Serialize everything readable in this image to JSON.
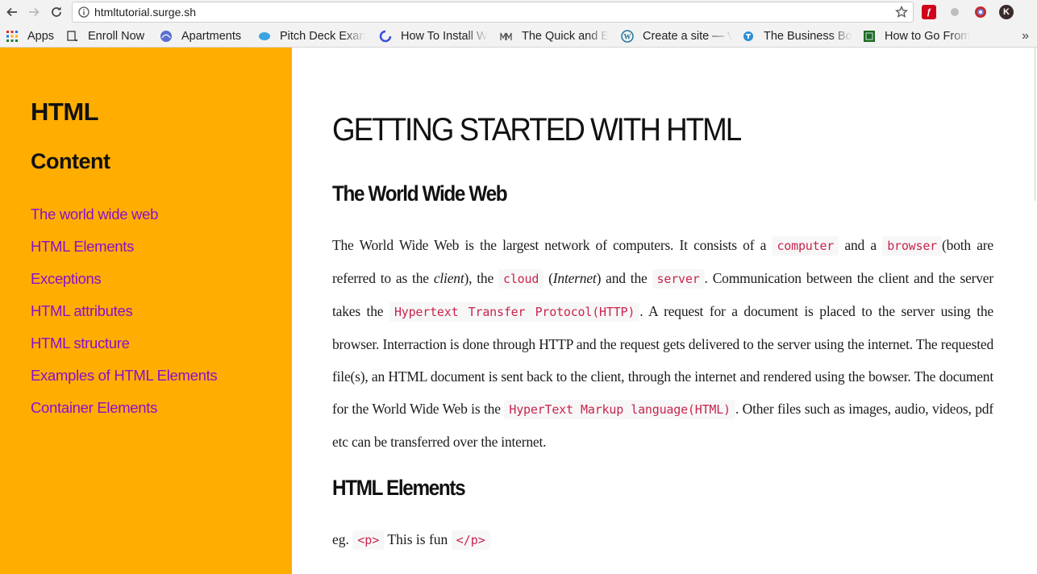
{
  "browser": {
    "url": "htmltutorial.surge.sh",
    "bookmarks": [
      {
        "label": "Apps",
        "icon": "apps-grid-icon"
      },
      {
        "label": "Enroll Now",
        "icon": "enroll-icon"
      },
      {
        "label": "Apartments",
        "icon": "apartments-icon"
      },
      {
        "label": "Pitch Deck Exan",
        "icon": "pitch-deck-icon"
      },
      {
        "label": "How To Install W",
        "icon": "how-to-install-icon"
      },
      {
        "label": "The Quick and E",
        "icon": "quick-and-icon"
      },
      {
        "label": "Create a site — V",
        "icon": "wordpress-icon"
      },
      {
        "label": "The Business Bo",
        "icon": "business-icon"
      },
      {
        "label": "How to Go From",
        "icon": "go-from-icon"
      }
    ],
    "more_symbol": "»"
  },
  "sidebar": {
    "title": "HTML",
    "subtitle": "Content",
    "links": [
      "The world wide web",
      "HTML Elements",
      "Exceptions",
      "HTML attributes",
      "HTML structure",
      "Examples of HTML Elements",
      "Container Elements"
    ]
  },
  "main": {
    "title": "GETTING STARTED WITH HTML",
    "section1": {
      "heading": "The World Wide Web",
      "t1": "The World Wide Web is the largest network of computers. It consists of a ",
      "c1": "computer",
      "t2": " and a ",
      "c2": "browser",
      "t3": "(both are referred to as the ",
      "e1": "client",
      "t4": "), the ",
      "c3": "cloud",
      "t5": " (",
      "e2": "Internet",
      "t6": ") and the ",
      "c4": "server",
      "t7": ". Communication between the client and the server takes the ",
      "c5": "Hypertext Transfer Protocol(HTTP)",
      "t8": ". A request for a document is placed to the server using the browser. Interraction is done through HTTP and the request gets delivered to the server using the internet. The requested file(s), an HTML document is sent back to the client, through the internet and rendered using the bowser. The document for the World Wide Web is the ",
      "c6": "HyperText Markup language(HTML)",
      "t9": ". Other files such as images, audio, videos, pdf etc can be transferred over the internet."
    },
    "section2": {
      "heading": "HTML Elements",
      "eg": "eg. ",
      "open_tag": "<p>",
      "text": " This is fun ",
      "close_tag": "</p>"
    }
  },
  "colors": {
    "sidebar_bg": "#ffad00",
    "link": "#8a0fd0",
    "code": "#c7254e"
  }
}
